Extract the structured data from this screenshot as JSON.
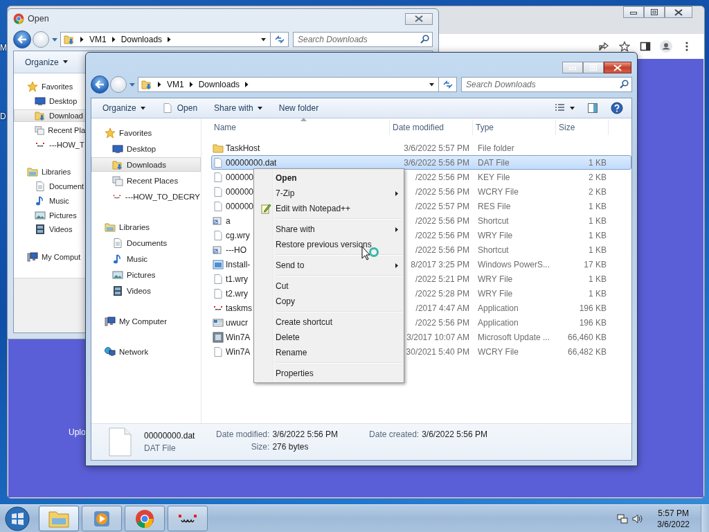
{
  "desktop": {
    "icon_labels": [
      "M",
      "D"
    ]
  },
  "browser": {
    "page_text": "Uplo"
  },
  "open_dialog": {
    "title": "Open",
    "address": [
      "VM1",
      "Downloads"
    ],
    "search": {
      "placeholder": "Search Downloads"
    },
    "toolbar": [
      {
        "label": "Organize",
        "dropdown": true,
        "has_icon": false
      }
    ],
    "nav": [
      {
        "label": "Favorites",
        "kind": "favorites",
        "selected": false,
        "children": [
          {
            "label": "Desktop",
            "kind": "desktop",
            "selected": false
          },
          {
            "label": "Download",
            "kind": "downloads",
            "selected": true
          },
          {
            "label": "Recent Pla",
            "kind": "recent",
            "selected": false
          },
          {
            "label": "---HOW_T",
            "kind": "face",
            "selected": false
          }
        ]
      },
      {
        "label": "Libraries",
        "kind": "libraries",
        "selected": false,
        "children": [
          {
            "label": "Document",
            "kind": "documents",
            "selected": false
          },
          {
            "label": "Music",
            "kind": "music",
            "selected": false
          },
          {
            "label": "Pictures",
            "kind": "pictures",
            "selected": false
          },
          {
            "label": "Videos",
            "kind": "videos",
            "selected": false
          }
        ]
      },
      {
        "label": "My Comput",
        "kind": "computer",
        "selected": false
      }
    ]
  },
  "explorer": {
    "address": [
      "VM1",
      "Downloads"
    ],
    "search": {
      "placeholder": "Search Downloads"
    },
    "toolbar": [
      {
        "label": "Organize",
        "dropdown": true,
        "has_icon": false
      },
      {
        "label": "Open",
        "dropdown": false,
        "has_icon": true
      },
      {
        "label": "Share with",
        "dropdown": true,
        "has_icon": false
      },
      {
        "label": "New folder",
        "dropdown": false,
        "has_icon": false
      }
    ],
    "nav": [
      {
        "label": "Favorites",
        "kind": "favorites",
        "selected": false,
        "children": [
          {
            "label": "Desktop",
            "kind": "desktop",
            "selected": false
          },
          {
            "label": "Downloads",
            "kind": "downloads",
            "selected": true
          },
          {
            "label": "Recent Places",
            "kind": "recent",
            "selected": false
          },
          {
            "label": "---HOW_TO_DECRY",
            "kind": "face",
            "selected": false
          }
        ]
      },
      {
        "label": "Libraries",
        "kind": "libraries",
        "selected": false,
        "children": [
          {
            "label": "Documents",
            "kind": "documents",
            "selected": false
          },
          {
            "label": "Music",
            "kind": "music",
            "selected": false
          },
          {
            "label": "Pictures",
            "kind": "pictures",
            "selected": false
          },
          {
            "label": "Videos",
            "kind": "videos",
            "selected": false
          }
        ]
      },
      {
        "label": "My Computer",
        "kind": "computer",
        "selected": false
      },
      {
        "label": "Network",
        "kind": "network",
        "selected": false
      }
    ],
    "columns": [
      {
        "label": "Name",
        "sorted": true
      },
      {
        "label": "Date modified",
        "sorted": false
      },
      {
        "label": "Type",
        "sorted": false
      },
      {
        "label": "Size",
        "sorted": false
      }
    ],
    "rows": [
      {
        "name": "TaskHost",
        "kind": "folder",
        "date_modified": "3/6/2022 5:57 PM",
        "type": "File folder",
        "selected": false
      },
      {
        "name": "00000000.dat",
        "kind": "file",
        "date_modified": "3/6/2022 5:56 PM",
        "type": "DAT File",
        "size": "1 KB",
        "selected": true
      },
      {
        "name": "000000",
        "kind": "file",
        "date_modified": "/2022 5:56 PM",
        "type": "KEY File",
        "size": "2 KB",
        "selected": false
      },
      {
        "name": "000000",
        "kind": "file",
        "date_modified": "/2022 5:56 PM",
        "type": "WCRY File",
        "size": "2 KB",
        "selected": false
      },
      {
        "name": "000000",
        "kind": "file",
        "date_modified": "/2022 5:57 PM",
        "type": "RES File",
        "size": "1 KB",
        "selected": false
      },
      {
        "name": "a",
        "kind": "shortcut",
        "date_modified": "/2022 5:56 PM",
        "type": "Shortcut",
        "size": "1 KB",
        "selected": false
      },
      {
        "name": "cg.wry",
        "kind": "file",
        "date_modified": "/2022 5:56 PM",
        "type": "WRY File",
        "size": "1 KB",
        "selected": false
      },
      {
        "name": "---HO",
        "kind": "shortcut",
        "date_modified": "/2022 5:56 PM",
        "type": "Shortcut",
        "size": "1 KB",
        "selected": false
      },
      {
        "name": "Install-",
        "kind": "script",
        "date_modified": "8/2017 3:25 PM",
        "type": "Windows PowerS...",
        "size": "17 KB",
        "selected": false
      },
      {
        "name": "t1.wry",
        "kind": "file",
        "date_modified": "/2022 5:21 PM",
        "type": "WRY File",
        "size": "1 KB",
        "selected": false
      },
      {
        "name": "t2.wry",
        "kind": "file",
        "date_modified": "/2022 5:28 PM",
        "type": "WRY File",
        "size": "1 KB",
        "selected": false
      },
      {
        "name": "taskms",
        "kind": "face",
        "date_modified": "/2017 4:47 AM",
        "type": "Application",
        "size": "196 KB",
        "selected": false
      },
      {
        "name": "uwucr",
        "kind": "app",
        "date_modified": "/2022 5:56 PM",
        "type": "Application",
        "size": "196 KB",
        "selected": false
      },
      {
        "name": "Win7A",
        "kind": "package",
        "date_modified": "3/2017 10:07 AM",
        "type": "Microsoft Update ...",
        "size": "66,460 KB",
        "selected": false
      },
      {
        "name": "Win7A",
        "kind": "file",
        "date_modified": "30/2021 5:40 PM",
        "type": "WCRY File",
        "size": "66,482 KB",
        "selected": false
      }
    ],
    "details": {
      "name": "00000000.dat",
      "type": "DAT File",
      "fields": [
        {
          "label": "Date modified:",
          "value": "3/6/2022 5:56 PM"
        },
        {
          "label": "Size:",
          "value": "276 bytes"
        },
        {
          "label": "Date created:",
          "value": "3/6/2022 5:56 PM"
        }
      ]
    }
  },
  "context_menu": {
    "groups": [
      [
        {
          "label": "Open",
          "default": true,
          "submenu": false,
          "has_icon": false
        },
        {
          "label": "7-Zip",
          "default": false,
          "submenu": true,
          "has_icon": false
        },
        {
          "label": "Edit with Notepad++",
          "default": false,
          "submenu": false,
          "has_icon": true
        }
      ],
      [
        {
          "label": "Share with",
          "default": false,
          "submenu": true,
          "has_icon": false
        },
        {
          "label": "Restore previous versions",
          "default": false,
          "submenu": false,
          "has_icon": false
        }
      ],
      [
        {
          "label": "Send to",
          "default": false,
          "submenu": true,
          "has_icon": false
        }
      ],
      [
        {
          "label": "Cut",
          "default": false,
          "submenu": false,
          "has_icon": false
        },
        {
          "label": "Copy",
          "default": false,
          "submenu": false,
          "has_icon": false
        }
      ],
      [
        {
          "label": "Create shortcut",
          "default": false,
          "submenu": false,
          "has_icon": false
        },
        {
          "label": "Delete",
          "default": false,
          "submenu": false,
          "has_icon": false
        },
        {
          "label": "Rename",
          "default": false,
          "submenu": false,
          "has_icon": false
        }
      ],
      [
        {
          "label": "Properties",
          "default": false,
          "submenu": false,
          "has_icon": false
        }
      ]
    ]
  },
  "taskbar": {
    "apps": [
      {
        "kind": "folder",
        "active": true
      },
      {
        "kind": "media",
        "active": false
      },
      {
        "kind": "browser",
        "active": false
      },
      {
        "kind": "face",
        "active": false
      }
    ],
    "clock": {
      "time": "5:57 PM",
      "date": "3/6/2022"
    }
  }
}
